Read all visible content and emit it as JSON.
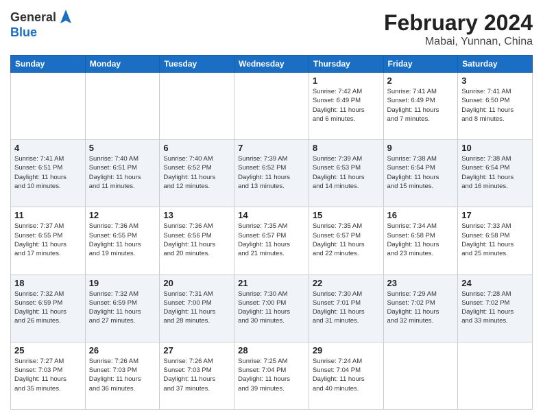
{
  "logo": {
    "general": "General",
    "blue": "Blue"
  },
  "header": {
    "title": "February 2024",
    "subtitle": "Mabai, Yunnan, China"
  },
  "weekdays": [
    "Sunday",
    "Monday",
    "Tuesday",
    "Wednesday",
    "Thursday",
    "Friday",
    "Saturday"
  ],
  "weeks": [
    [
      {
        "day": "",
        "info": ""
      },
      {
        "day": "",
        "info": ""
      },
      {
        "day": "",
        "info": ""
      },
      {
        "day": "",
        "info": ""
      },
      {
        "day": "1",
        "info": "Sunrise: 7:42 AM\nSunset: 6:49 PM\nDaylight: 11 hours\nand 6 minutes."
      },
      {
        "day": "2",
        "info": "Sunrise: 7:41 AM\nSunset: 6:49 PM\nDaylight: 11 hours\nand 7 minutes."
      },
      {
        "day": "3",
        "info": "Sunrise: 7:41 AM\nSunset: 6:50 PM\nDaylight: 11 hours\nand 8 minutes."
      }
    ],
    [
      {
        "day": "4",
        "info": "Sunrise: 7:41 AM\nSunset: 6:51 PM\nDaylight: 11 hours\nand 10 minutes."
      },
      {
        "day": "5",
        "info": "Sunrise: 7:40 AM\nSunset: 6:51 PM\nDaylight: 11 hours\nand 11 minutes."
      },
      {
        "day": "6",
        "info": "Sunrise: 7:40 AM\nSunset: 6:52 PM\nDaylight: 11 hours\nand 12 minutes."
      },
      {
        "day": "7",
        "info": "Sunrise: 7:39 AM\nSunset: 6:52 PM\nDaylight: 11 hours\nand 13 minutes."
      },
      {
        "day": "8",
        "info": "Sunrise: 7:39 AM\nSunset: 6:53 PM\nDaylight: 11 hours\nand 14 minutes."
      },
      {
        "day": "9",
        "info": "Sunrise: 7:38 AM\nSunset: 6:54 PM\nDaylight: 11 hours\nand 15 minutes."
      },
      {
        "day": "10",
        "info": "Sunrise: 7:38 AM\nSunset: 6:54 PM\nDaylight: 11 hours\nand 16 minutes."
      }
    ],
    [
      {
        "day": "11",
        "info": "Sunrise: 7:37 AM\nSunset: 6:55 PM\nDaylight: 11 hours\nand 17 minutes."
      },
      {
        "day": "12",
        "info": "Sunrise: 7:36 AM\nSunset: 6:55 PM\nDaylight: 11 hours\nand 19 minutes."
      },
      {
        "day": "13",
        "info": "Sunrise: 7:36 AM\nSunset: 6:56 PM\nDaylight: 11 hours\nand 20 minutes."
      },
      {
        "day": "14",
        "info": "Sunrise: 7:35 AM\nSunset: 6:57 PM\nDaylight: 11 hours\nand 21 minutes."
      },
      {
        "day": "15",
        "info": "Sunrise: 7:35 AM\nSunset: 6:57 PM\nDaylight: 11 hours\nand 22 minutes."
      },
      {
        "day": "16",
        "info": "Sunrise: 7:34 AM\nSunset: 6:58 PM\nDaylight: 11 hours\nand 23 minutes."
      },
      {
        "day": "17",
        "info": "Sunrise: 7:33 AM\nSunset: 6:58 PM\nDaylight: 11 hours\nand 25 minutes."
      }
    ],
    [
      {
        "day": "18",
        "info": "Sunrise: 7:32 AM\nSunset: 6:59 PM\nDaylight: 11 hours\nand 26 minutes."
      },
      {
        "day": "19",
        "info": "Sunrise: 7:32 AM\nSunset: 6:59 PM\nDaylight: 11 hours\nand 27 minutes."
      },
      {
        "day": "20",
        "info": "Sunrise: 7:31 AM\nSunset: 7:00 PM\nDaylight: 11 hours\nand 28 minutes."
      },
      {
        "day": "21",
        "info": "Sunrise: 7:30 AM\nSunset: 7:00 PM\nDaylight: 11 hours\nand 30 minutes."
      },
      {
        "day": "22",
        "info": "Sunrise: 7:30 AM\nSunset: 7:01 PM\nDaylight: 11 hours\nand 31 minutes."
      },
      {
        "day": "23",
        "info": "Sunrise: 7:29 AM\nSunset: 7:02 PM\nDaylight: 11 hours\nand 32 minutes."
      },
      {
        "day": "24",
        "info": "Sunrise: 7:28 AM\nSunset: 7:02 PM\nDaylight: 11 hours\nand 33 minutes."
      }
    ],
    [
      {
        "day": "25",
        "info": "Sunrise: 7:27 AM\nSunset: 7:03 PM\nDaylight: 11 hours\nand 35 minutes."
      },
      {
        "day": "26",
        "info": "Sunrise: 7:26 AM\nSunset: 7:03 PM\nDaylight: 11 hours\nand 36 minutes."
      },
      {
        "day": "27",
        "info": "Sunrise: 7:26 AM\nSunset: 7:03 PM\nDaylight: 11 hours\nand 37 minutes."
      },
      {
        "day": "28",
        "info": "Sunrise: 7:25 AM\nSunset: 7:04 PM\nDaylight: 11 hours\nand 39 minutes."
      },
      {
        "day": "29",
        "info": "Sunrise: 7:24 AM\nSunset: 7:04 PM\nDaylight: 11 hours\nand 40 minutes."
      },
      {
        "day": "",
        "info": ""
      },
      {
        "day": "",
        "info": ""
      }
    ]
  ]
}
